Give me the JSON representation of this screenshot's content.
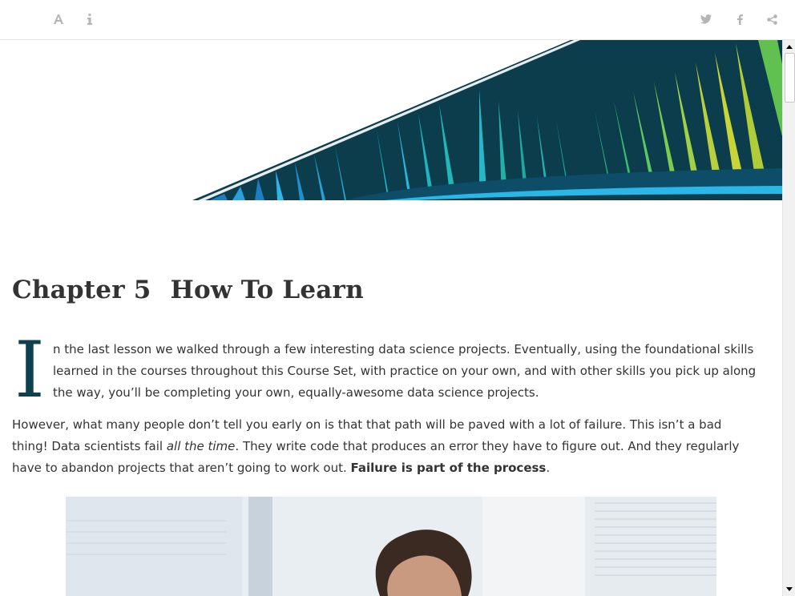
{
  "toolbar": {
    "left_icons": [
      "font-settings-icon",
      "info-icon"
    ],
    "right_icons": [
      "twitter-icon",
      "facebook-icon",
      "share-icon"
    ]
  },
  "chapter": {
    "number_label": "Chapter 5",
    "title": "How To Learn"
  },
  "body": {
    "dropcap": "I",
    "para1": "n the last lesson we walked through a few interesting data science projects. Eventually, using the foundational skills learned in the courses throughout this Course Set, with practice on your own, and with other skills you pick up along the way, you’ll be completing your own, equally-awesome data science projects.",
    "para2_a": "However, what many people don’t tell you early on is that that path will be paved with a lot of failure. This isn’t a bad thing! Data scientists fail ",
    "para2_em": "all the time",
    "para2_b": ". They write code that produces an error they have to figure out. And they regularly have to abandon projects that aren’t going to work out. ",
    "para2_strong": "Failure is part of the process",
    "para2_end": "."
  },
  "colors": {
    "accent": "#0d4150",
    "icon_gray": "#b5b5b5",
    "text": "#333333"
  }
}
